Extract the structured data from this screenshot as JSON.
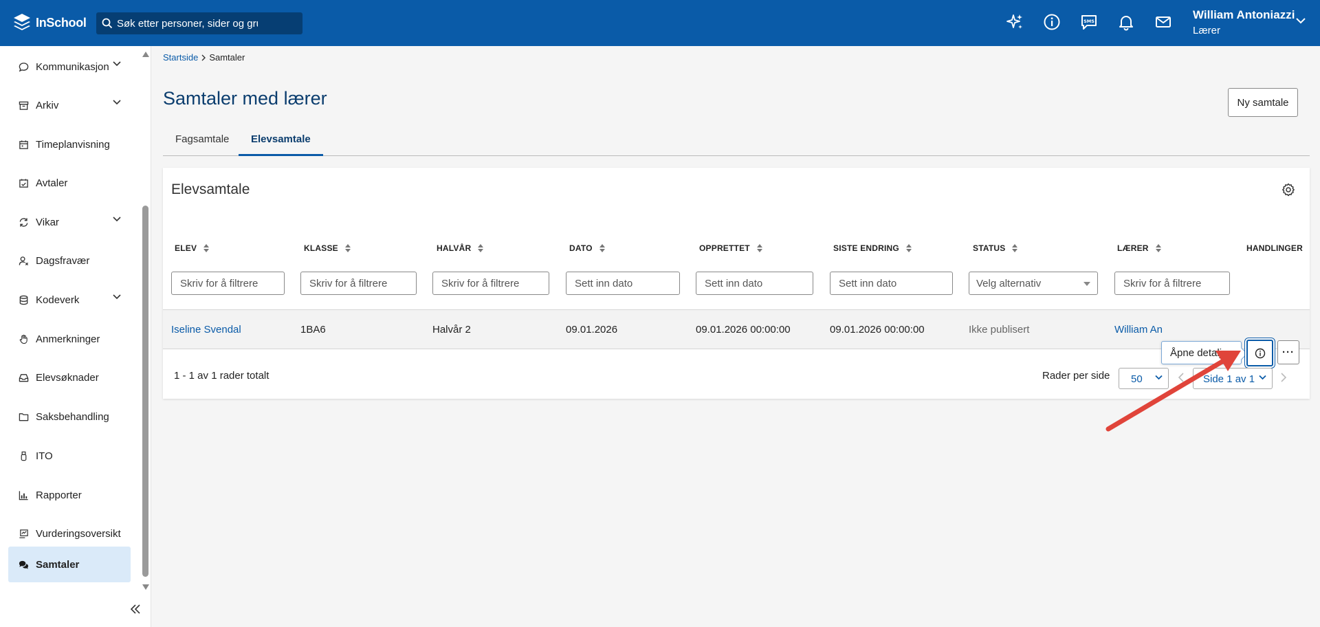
{
  "brand": {
    "name": "InSchool"
  },
  "search": {
    "placeholder": "Søk etter personer, sider og gru"
  },
  "header": {
    "icons": [
      "sparkle-icon",
      "info-icon",
      "sms-icon",
      "bell-icon",
      "mail-icon"
    ],
    "user_name": "William Antoniazzi",
    "user_role": "Lærer"
  },
  "sidebar": {
    "items": [
      {
        "label": "Kommunikasjon",
        "icon": "chat-bubble-icon",
        "has_submenu": true
      },
      {
        "label": "Arkiv",
        "icon": "archive-box-icon",
        "has_submenu": true
      },
      {
        "label": "Timeplanvisning",
        "icon": "calendar-icon",
        "has_submenu": false
      },
      {
        "label": "Avtaler",
        "icon": "calendar-check-icon",
        "has_submenu": false
      },
      {
        "label": "Vikar",
        "icon": "swap-icon",
        "has_submenu": true
      },
      {
        "label": "Dagsfravær",
        "icon": "user-absence-icon",
        "has_submenu": false
      },
      {
        "label": "Kodeverk",
        "icon": "database-icon",
        "has_submenu": true
      },
      {
        "label": "Anmerkninger",
        "icon": "hand-icon",
        "has_submenu": false
      },
      {
        "label": "Elevsøknader",
        "icon": "inbox-icon",
        "has_submenu": false
      },
      {
        "label": "Saksbehandling",
        "icon": "folder-icon",
        "has_submenu": false
      },
      {
        "label": "ITO",
        "icon": "usb-icon",
        "has_submenu": false
      },
      {
        "label": "Rapporter",
        "icon": "bar-chart-icon",
        "has_submenu": false
      },
      {
        "label": "Vurderingsoversikt",
        "icon": "assessment-icon",
        "has_submenu": false
      },
      {
        "label": "Samtaler",
        "icon": "conversation-icon",
        "has_submenu": false,
        "active": true
      }
    ]
  },
  "breadcrumb": {
    "home": "Startside",
    "current": "Samtaler"
  },
  "page": {
    "title": "Samtaler med lærer",
    "new_button": "Ny samtale"
  },
  "tabs": [
    {
      "label": "Fagsamtale",
      "active": false
    },
    {
      "label": "Elevsamtale",
      "active": true
    }
  ],
  "table": {
    "title": "Elevsamtale",
    "columns": [
      "ELEV",
      "KLASSE",
      "HALVÅR",
      "DATO",
      "OPPRETTET",
      "SISTE ENDRING",
      "STATUS",
      "LÆRER",
      "HANDLINGER"
    ],
    "filters": {
      "text": "Skriv for å filtrere",
      "date": "Sett inn dato",
      "select": "Velg alternativ"
    },
    "rows": [
      {
        "elev": "Iseline Svendal",
        "klasse": "1BA6",
        "halvar": "Halvår 2",
        "dato": "09.01.2026",
        "opprettet": "09.01.2026 00:00:00",
        "siste_endring": "09.01.2026 00:00:00",
        "status": "Ikke publisert",
        "laerer": "William An"
      }
    ],
    "tooltip": "Åpne detaljer",
    "more_label": "···",
    "footer": {
      "summary": "1 - 1 av 1 rader totalt",
      "rows_per_page_label": "Rader per side",
      "rows_per_page": "50",
      "page": "Side 1 av 1"
    }
  },
  "colors": {
    "primary": "#0a5ba8",
    "title": "#0b3d6e",
    "annotation_arrow": "#e0443a"
  }
}
